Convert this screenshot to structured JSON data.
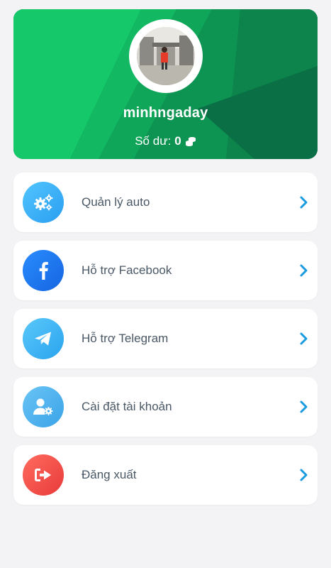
{
  "profile": {
    "username": "minhngaday",
    "balance_label": "Số dư:",
    "balance_value": "0"
  },
  "menu": {
    "items": [
      {
        "id": "auto",
        "label": "Quản lý auto",
        "icon": "gears-icon",
        "color": "#3ab0f5"
      },
      {
        "id": "facebook",
        "label": "Hỗ trợ Facebook",
        "icon": "facebook-icon",
        "color": "#1877f2"
      },
      {
        "id": "telegram",
        "label": "Hỗ trợ Telegram",
        "icon": "telegram-icon",
        "color": "#35aef0"
      },
      {
        "id": "account",
        "label": "Cài đặt tài khoản",
        "icon": "user-settings-icon",
        "color": "#4fb3ef"
      },
      {
        "id": "logout",
        "label": "Đăng xuất",
        "icon": "logout-icon",
        "color": "#ef4444"
      }
    ]
  },
  "colors": {
    "card_green": "#0b7a4c",
    "accent_blue": "#1a9be0",
    "text": "#4a5866"
  }
}
